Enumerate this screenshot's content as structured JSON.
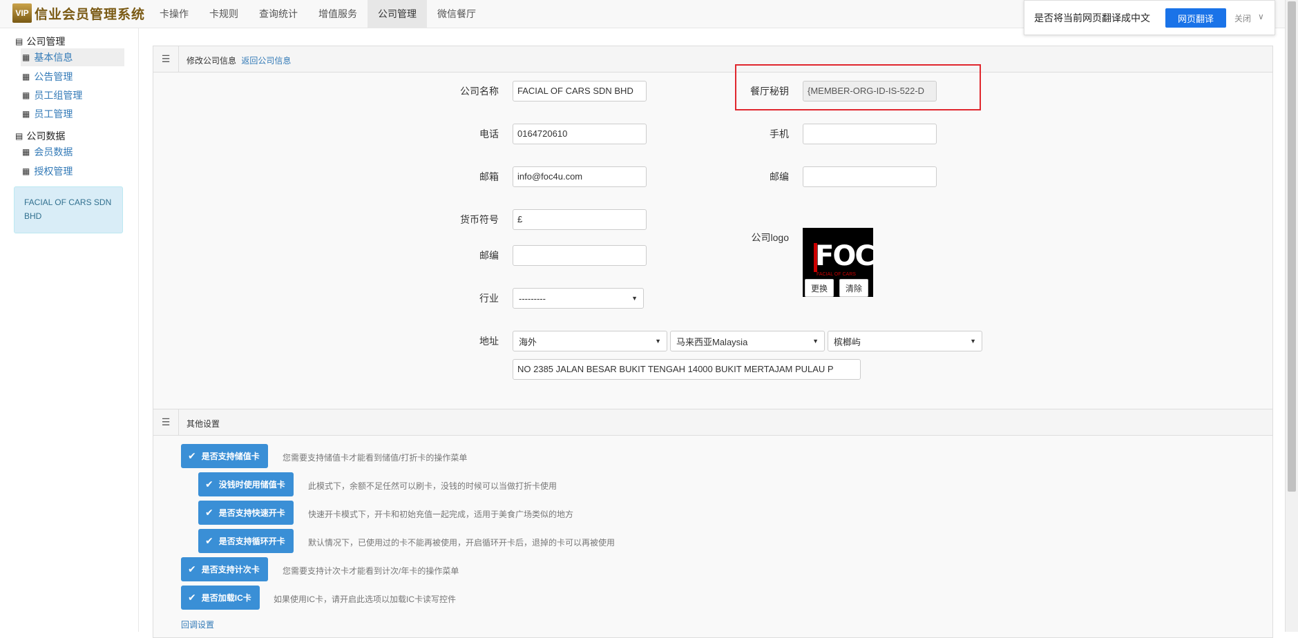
{
  "brand": {
    "mark": "VIP",
    "title": "信业会员管理系统"
  },
  "nav": {
    "items": [
      "卡操作",
      "卡规则",
      "查询统计",
      "增值服务",
      "公司管理",
      "微信餐厅"
    ],
    "active": "公司管理"
  },
  "translate_bar": {
    "prompt": "是否将当前网页翻译成中文",
    "button": "网页翻译",
    "close": "关闭",
    "chevron": "∨"
  },
  "sidebar": {
    "group1": "公司管理",
    "group1_items": [
      "基本信息",
      "公告管理",
      "员工组管理",
      "员工管理"
    ],
    "group2": "公司数据",
    "group2_items": [
      "会员数据",
      "授权管理"
    ],
    "company_name": "FACIAL OF CARS SDN BHD"
  },
  "form_panel": {
    "title": "修改公司信息",
    "back_link": "返回公司信息",
    "fields": {
      "company_name": {
        "label": "公司名称",
        "value": "FACIAL OF CARS SDN BHD"
      },
      "secret": {
        "label": "餐厅秘钥",
        "value": "{MEMBER-ORG-ID-IS-522-D"
      },
      "phone": {
        "label": "电话",
        "value": "0164720610"
      },
      "mobile": {
        "label": "手机",
        "value": ""
      },
      "email": {
        "label": "邮箱",
        "value": "info@foc4u.com"
      },
      "postcode_right": {
        "label": "邮编",
        "value": ""
      },
      "currency": {
        "label": "货币符号",
        "value": "£"
      },
      "postcode": {
        "label": "邮编",
        "value": ""
      },
      "industry": {
        "label": "行业",
        "value": "---------"
      },
      "logo": {
        "label": "公司logo",
        "logo_text": "FOC",
        "logo_sub": "FACIAL OF CARS",
        "replace": "更换",
        "clear": "清除"
      },
      "address": {
        "label": "地址",
        "region": "海外",
        "country": "马来西亚Malaysia",
        "state": "槟榔屿",
        "street": "NO 2385 JALAN BESAR BUKIT TENGAH 14000 BUKIT MERTAJAM PULAU P"
      }
    }
  },
  "other_panel": {
    "title": "其他设置",
    "options": [
      {
        "label": "是否支持储值卡",
        "desc": "您需要支持储值卡才能看到储值/打折卡的操作菜单"
      },
      {
        "label": "没钱时使用储值卡",
        "desc": "此模式下，余额不足任然可以刷卡，没钱的时候可以当做打折卡使用"
      },
      {
        "label": "是否支持快速开卡",
        "desc": "快速开卡模式下，开卡和初始充值一起完成，适用于美食广场类似的地方"
      },
      {
        "label": "是否支持循环开卡",
        "desc": "默认情况下，已使用过的卡不能再被使用，开启循环开卡后，退掉的卡可以再被使用"
      },
      {
        "label": "是否支持计次卡",
        "desc": "您需要支持计次卡才能看到计次/年卡的操作菜单"
      },
      {
        "label": "是否加载IC卡",
        "desc": "如果使用IC卡，请开启此选项以加载IC卡读写控件"
      }
    ],
    "callback_link": "回调设置"
  },
  "colors": {
    "accent": "#3a8fd6",
    "link": "#337ab7",
    "highlight_box": "#e0262d",
    "translate_button": "#1a73e8"
  }
}
